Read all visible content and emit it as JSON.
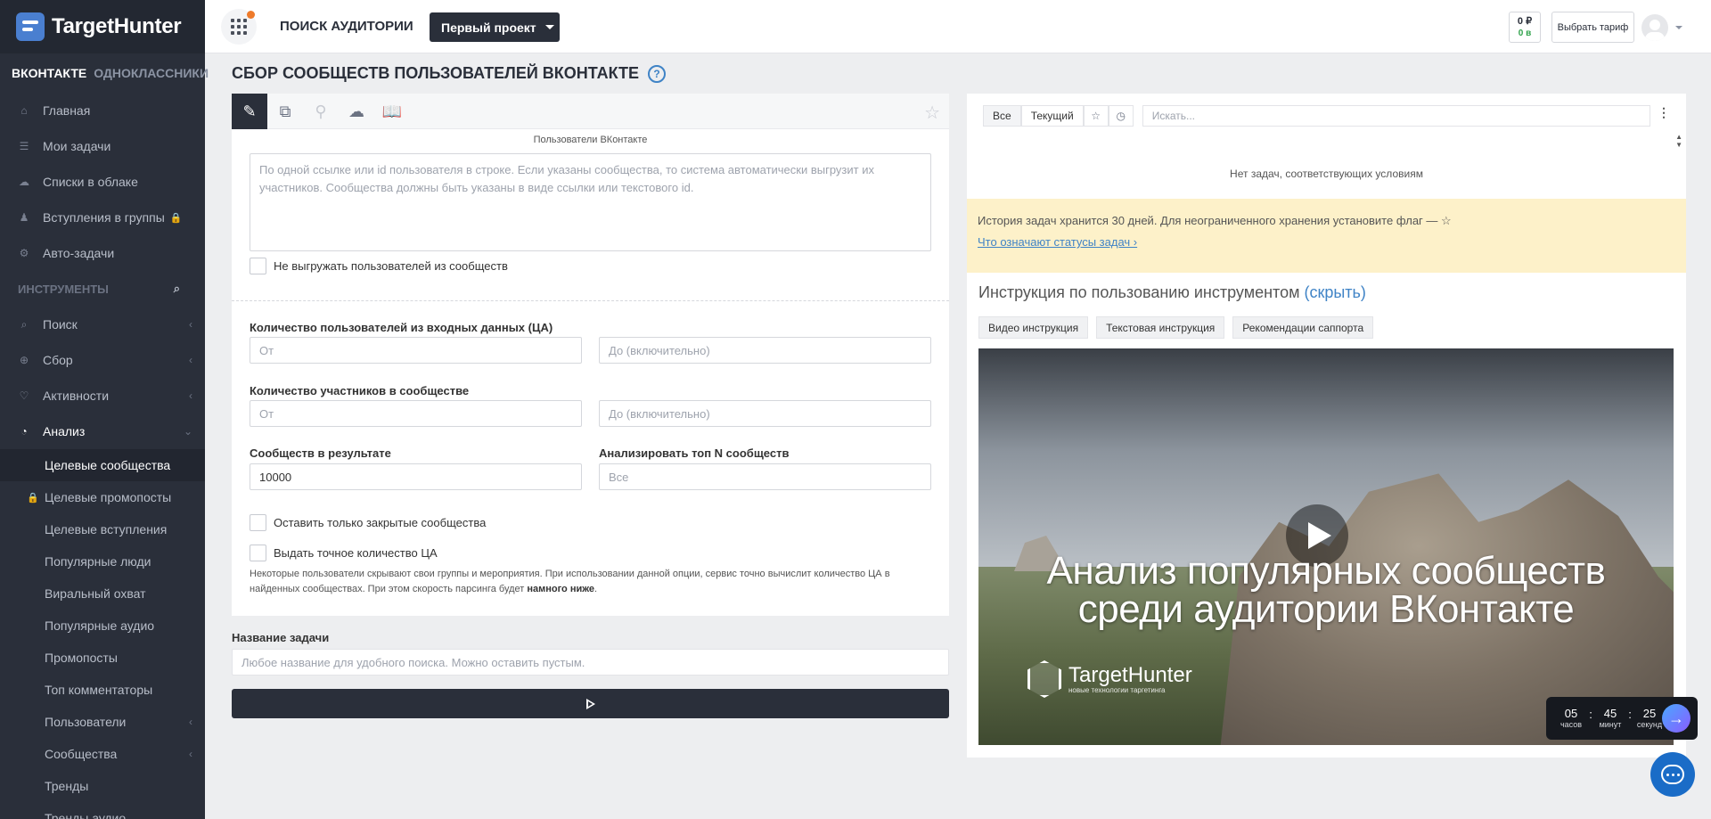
{
  "brand": {
    "name": "TargetHunter"
  },
  "header": {
    "section_title": "ПОИСК АУДИТОРИИ",
    "project_label": "Первый проект",
    "balance_rub": "0 ₽",
    "balance_bonus": "0 в",
    "tariff_label": "Выбрать тариф"
  },
  "sidebar": {
    "social_tabs": [
      "ВКОНТАКТЕ",
      "ОДНОКЛАССНИКИ"
    ],
    "main_items": [
      {
        "label": "Главная",
        "icon": "home-icon"
      },
      {
        "label": "Мои задачи",
        "icon": "list-icon"
      },
      {
        "label": "Списки в облаке",
        "icon": "cloud-icon"
      },
      {
        "label": "Вступления в группы",
        "icon": "users-icon",
        "locked": true
      },
      {
        "label": "Авто-задачи",
        "icon": "gears-icon"
      }
    ],
    "tools_title": "ИНСТРУМЕНТЫ",
    "tools": [
      {
        "label": "Поиск",
        "icon": "search-icon"
      },
      {
        "label": "Сбор",
        "icon": "zoom-icon"
      },
      {
        "label": "Активности",
        "icon": "heart-icon"
      },
      {
        "label": "Анализ",
        "icon": "chart-icon"
      }
    ],
    "analysis_items": [
      {
        "label": "Целевые сообщества",
        "current": true
      },
      {
        "label": "Целевые промопосты",
        "locked": true
      },
      {
        "label": "Целевые вступления"
      },
      {
        "label": "Популярные люди"
      },
      {
        "label": "Виральный охват"
      },
      {
        "label": "Популярные аудио"
      },
      {
        "label": "Промопосты"
      },
      {
        "label": "Топ комментаторы"
      },
      {
        "label": "Пользователи",
        "expandable": true
      },
      {
        "label": "Сообщества",
        "expandable": true
      },
      {
        "label": "Тренды"
      },
      {
        "label": "Тренды аудио"
      }
    ]
  },
  "page": {
    "title": "СБОР СООБЩЕСТВ ПОЛЬЗОВАТЕЛЕЙ ВКОНТАКТЕ",
    "help_icon": "?"
  },
  "form": {
    "input_caption": "Пользователи ВКонтакте",
    "input_placeholder": "По одной ссылке или id пользователя в строке. Если указаны сообщества, то система автоматически выгрузит их участников. Сообщества должны быть указаны в виде ссылки или текстового id.",
    "no_unload_label": "Не выгружать пользователей из сообществ",
    "users_count_label": "Количество пользователей из входных данных (ЦА)",
    "members_count_label": "Количество участников в сообществе",
    "from_placeholder": "От",
    "to_placeholder": "До (включительно)",
    "result_label": "Сообществ в результате",
    "result_value": "10000",
    "top_n_label": "Анализировать топ N сообществ",
    "top_n_placeholder": "Все",
    "closed_only_label": "Оставить только закрытые сообщества",
    "exact_count_label": "Выдать точное количество ЦА",
    "note_text": "Некоторые пользователи скрывают свои группы и мероприятия. При использовании данной опции, сервис точно вычислит количество ЦА в найденных сообществах. При этом скорость парсинга будет ",
    "note_bold": "намного ниже",
    "note_end": ".",
    "task_name_label": "Название задачи",
    "task_name_placeholder": "Любое название для удобного поиска. Можно оставить пустым."
  },
  "tasks": {
    "filter_all": "Все",
    "filter_current": "Текущий",
    "search_placeholder": "Искать...",
    "empty_message": "Нет задач, соответствующих условиям",
    "history_notice": "История задач хранится 30 дней. Для неограниченного хранения установите флаг — ☆",
    "status_link": "Что означают статусы задач ›"
  },
  "instruction": {
    "title": "Инструкция по пользованию инструментом",
    "hide_link": "(скрыть)",
    "tabs": [
      "Видео инструкция",
      "Текстовая инструкция",
      "Рекомендации саппорта"
    ],
    "video_title_line1": "Анализ популярных сообществ",
    "video_title_line2": "среди аудитории ВКонтакте",
    "video_logo_text": "TargetHunter",
    "video_logo_sub": "новые технологии таргетинга"
  },
  "timer": {
    "hours": "05",
    "hours_label": "часов",
    "minutes": "45",
    "minutes_label": "минут",
    "seconds": "25",
    "seconds_label": "секунд",
    "sep": ":"
  }
}
